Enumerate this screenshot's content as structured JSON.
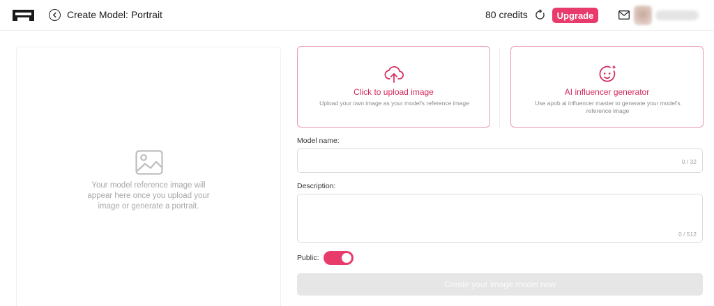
{
  "header": {
    "title": "Create Model: Portrait",
    "credits": "80 credits",
    "upgrade_label": "Upgrade"
  },
  "preview": {
    "placeholder_text": "Your model reference image will appear here once you upload your image or generate a portrait."
  },
  "cards": {
    "upload": {
      "title": "Click to upload image",
      "description": "Upload your own image as your model's reference image"
    },
    "ai": {
      "title": "AI influencer generator",
      "description": "Use apob ai influencer master to generate your model's reference image"
    }
  },
  "form": {
    "name_label": "Model name:",
    "name_value": "",
    "name_counter": "0 / 32",
    "description_label": "Description:",
    "description_value": "",
    "description_counter": "0 / 512",
    "public_label": "Public:",
    "public_enabled": true,
    "submit_label": "Create your image model now"
  },
  "colors": {
    "accent": "#e83a6b",
    "card_border": "#ea9ab2",
    "card_title": "#d32a5c",
    "disabled_button": "#e6e6e6"
  },
  "icons": {
    "logo": "logo-icon",
    "back": "back-arrow-icon",
    "refresh": "refresh-icon",
    "mail": "mail-icon",
    "preview": "image-placeholder-icon",
    "upload": "cloud-upload-icon",
    "ai": "face-sparkle-icon"
  }
}
